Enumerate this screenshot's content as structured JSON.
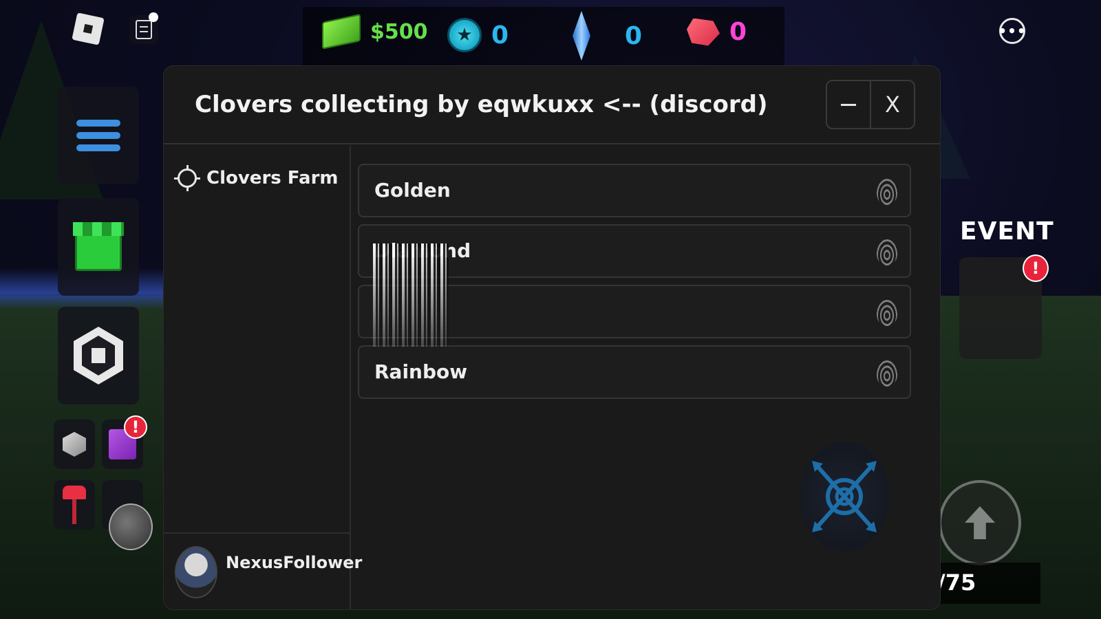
{
  "hud": {
    "cash": "$500",
    "stars": "0",
    "crystals": "0",
    "rubies": "0",
    "menu_dots": "•••"
  },
  "panel": {
    "title": "Clovers collecting by eqwkuxx <-- (discord)",
    "minimize_label": "",
    "close_label": "X"
  },
  "sidebar": {
    "tab_label": "Clovers Farm",
    "username": "NexusFollower"
  },
  "rows": [
    {
      "label": "Golden"
    },
    {
      "label": "Diamond"
    },
    {
      "label": ""
    },
    {
      "label": "Rainbow"
    }
  ],
  "game": {
    "event_label": "EVENT",
    "alert_mark": "!",
    "counter": "/75"
  },
  "colors": {
    "cash_green": "#66e04a",
    "currency_blue": "#2ab6ee",
    "currency_pink": "#ff45d8",
    "panel_bg": "#1a1a1a",
    "alert_red": "#e8243a"
  }
}
